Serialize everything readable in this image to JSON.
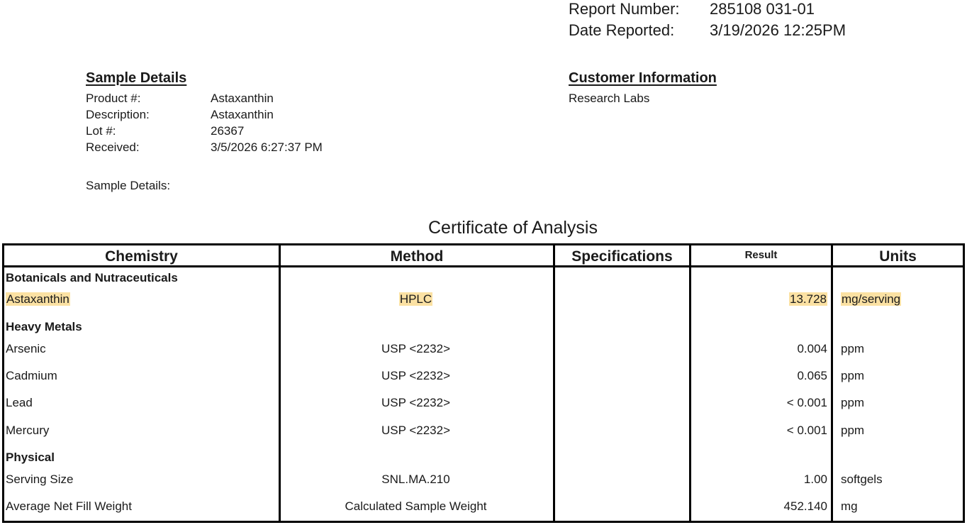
{
  "report": {
    "number_label": "Report Number:",
    "number_value": "285108 031-01",
    "date_label": "Date Reported:",
    "date_value": "3/19/2026 12:25PM"
  },
  "sample_details": {
    "title": "Sample Details",
    "product_label": "Product #:",
    "product_value": "Astaxanthin",
    "description_label": "Description:",
    "description_value": "Astaxanthin",
    "lot_label": "Lot #:",
    "lot_value": "26367",
    "received_label": "Received:",
    "received_value": "3/5/2026 6:27:37 PM",
    "extra_label": "Sample Details:"
  },
  "customer": {
    "title": "Customer Information",
    "name": "Research Labs"
  },
  "coa_title": "Certificate of Analysis",
  "table": {
    "headers": {
      "chemistry": "Chemistry",
      "method": "Method",
      "specifications": "Specifications",
      "result": "Result",
      "units": "Units"
    },
    "categories": {
      "botanicals": "Botanicals and Nutraceuticals",
      "heavy_metals": "Heavy Metals",
      "physical": "Physical"
    },
    "rows": [
      {
        "chemistry": "Astaxanthin",
        "method": "HPLC",
        "specifications": "",
        "result": "13.728",
        "units": "mg/serving"
      },
      {
        "chemistry": "Arsenic",
        "method": "USP <2232>",
        "specifications": "",
        "result": "0.004",
        "units": "ppm"
      },
      {
        "chemistry": "Cadmium",
        "method": "USP <2232>",
        "specifications": "",
        "result": "0.065",
        "units": "ppm"
      },
      {
        "chemistry": "Lead",
        "method": "USP <2232>",
        "specifications": "",
        "result": "< 0.001",
        "units": "ppm"
      },
      {
        "chemistry": "Mercury",
        "method": "USP <2232>",
        "specifications": "",
        "result": "< 0.001",
        "units": "ppm"
      },
      {
        "chemistry": "Serving Size",
        "method": "SNL.MA.210",
        "specifications": "",
        "result": "1.00",
        "units": "softgels"
      },
      {
        "chemistry": "Average Net Fill Weight",
        "method": "Calculated Sample Weight",
        "specifications": "",
        "result": "452.140",
        "units": "mg"
      }
    ]
  },
  "highlight_color": "#fbe1a3"
}
